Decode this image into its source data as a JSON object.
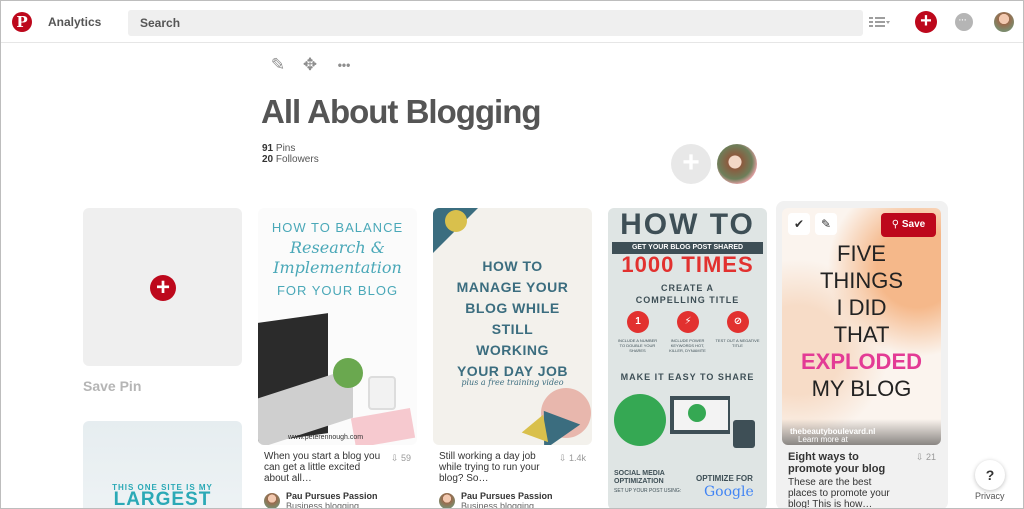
{
  "header": {
    "logo": "P",
    "analytics": "Analytics",
    "search_placeholder": "Search",
    "add_label": "+",
    "icons": [
      "pinterest-logo",
      "view-menu-icon",
      "plus-icon",
      "chat-icon",
      "avatar"
    ]
  },
  "board": {
    "tools": [
      "✎",
      "✥",
      "•••"
    ],
    "title": "All About Blogging",
    "pins_count": "91",
    "pins_label": "Pins",
    "followers_count": "20",
    "followers_label": "Followers",
    "collab_add": "+"
  },
  "save_pin": {
    "plus": "+",
    "label": "Save Pin"
  },
  "largest_card": {
    "line1": "THIS ONE SITE IS MY",
    "line2": "LARGEST"
  },
  "pins": [
    {
      "image_lines": [
        "HOW TO BALANCE",
        "Research &",
        "Implementation",
        "FOR YOUR BLOG"
      ],
      "image_url_text": "www.peterennough.com",
      "description": "When you start a blog you can get a little excited about all…",
      "count": "59",
      "author": "Pau Pursues Passion",
      "board": "Business blogging"
    },
    {
      "image_lines": [
        "HOW TO",
        "MANAGE YOUR",
        "BLOG WHILE",
        "STILL",
        "WORKING",
        "YOUR DAY JOB"
      ],
      "image_sub": "plus a free training video",
      "description": "Still working a day job while trying to run your blog? So…",
      "count": "1.4k",
      "author": "Pau Pursues Passion",
      "board": "Business blogging"
    },
    {
      "image_lines": [
        "HOW TO",
        "GET YOUR BLOG POST SHARED",
        "1000 TIMES",
        "CREATE A",
        "COMPELLING TITLE",
        "MAKE IT EASY TO SHARE"
      ],
      "image_small": [
        "INCLUDE A NUMBER TO DOUBLE YOUR SHARES",
        "INCLUDE POWER KEYWORDS HOT, KILLER, DYNAMITE",
        "TEST OUT A NEGATIVE TITLE"
      ],
      "bottom_left": "SOCIAL MEDIA OPTIMIZATION",
      "bottom_left_sub": "SET UP YOUR POST USING:",
      "bottom_right": "OPTIMIZE FOR",
      "bottom_right_brand": "Google"
    },
    {
      "image_lines": [
        "FIVE",
        "THINGS",
        "I DID",
        "THAT",
        "EXPLODED",
        "MY BLOG"
      ],
      "source_prefix": "Learn more at",
      "source_domain": "thebeautyboulevard.nl",
      "save_label": "Save",
      "check_icon": "✔",
      "edit_icon": "✎",
      "description": "Eight ways to promote your blog",
      "count": "21",
      "sub": "These are the best places to promote your blog! This is how…"
    }
  ],
  "help": {
    "label": "?",
    "privacy": "Privacy"
  },
  "colors": {
    "brand_red": "#bd081c",
    "teal": "#4aa8b8"
  }
}
